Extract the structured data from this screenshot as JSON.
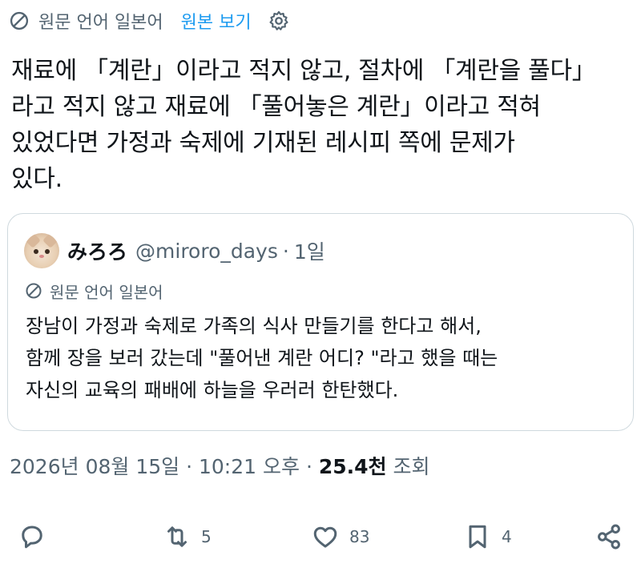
{
  "translate_bar": {
    "label": "원문 언어 일본어",
    "view_original": "원본 보기"
  },
  "tweet": {
    "lines": [
      "재료에 「계란」이라고 적지 않고, 절차에 「계란을 풀다」",
      "라고 적지 않고 재료에 「풀어놓은 계란」이라고 적혀",
      "있었다면 가정과 숙제에 기재된 레시피 쪽에 문제가",
      "있다."
    ]
  },
  "quote": {
    "name": "みろろ",
    "handle": "@miroro_days",
    "separator": "·",
    "time": "1일",
    "translate_label": "원문 언어 일본어",
    "lines": [
      "장남이 가정과 숙제로 가족의 식사 만들기를 한다고 해서,",
      "함께 장을 보러 갔는데 \"풀어낸 계란 어디? \"라고 했을 때는",
      "자신의 교육의 패배에 하늘을 우러러 한탄했다."
    ]
  },
  "meta": {
    "date": "2026년 08월 15일",
    "sep1": "·",
    "time": "10:21 오후",
    "sep2": "·",
    "views": "25.4천",
    "views_label": "조회"
  },
  "actions": {
    "reply_count": "",
    "retweet_count": "5",
    "like_count": "83",
    "bookmark_count": "4"
  },
  "colors": {
    "link": "#1d9bf0",
    "secondary": "#536471",
    "text": "#0f1419",
    "border": "#cfd9de"
  }
}
